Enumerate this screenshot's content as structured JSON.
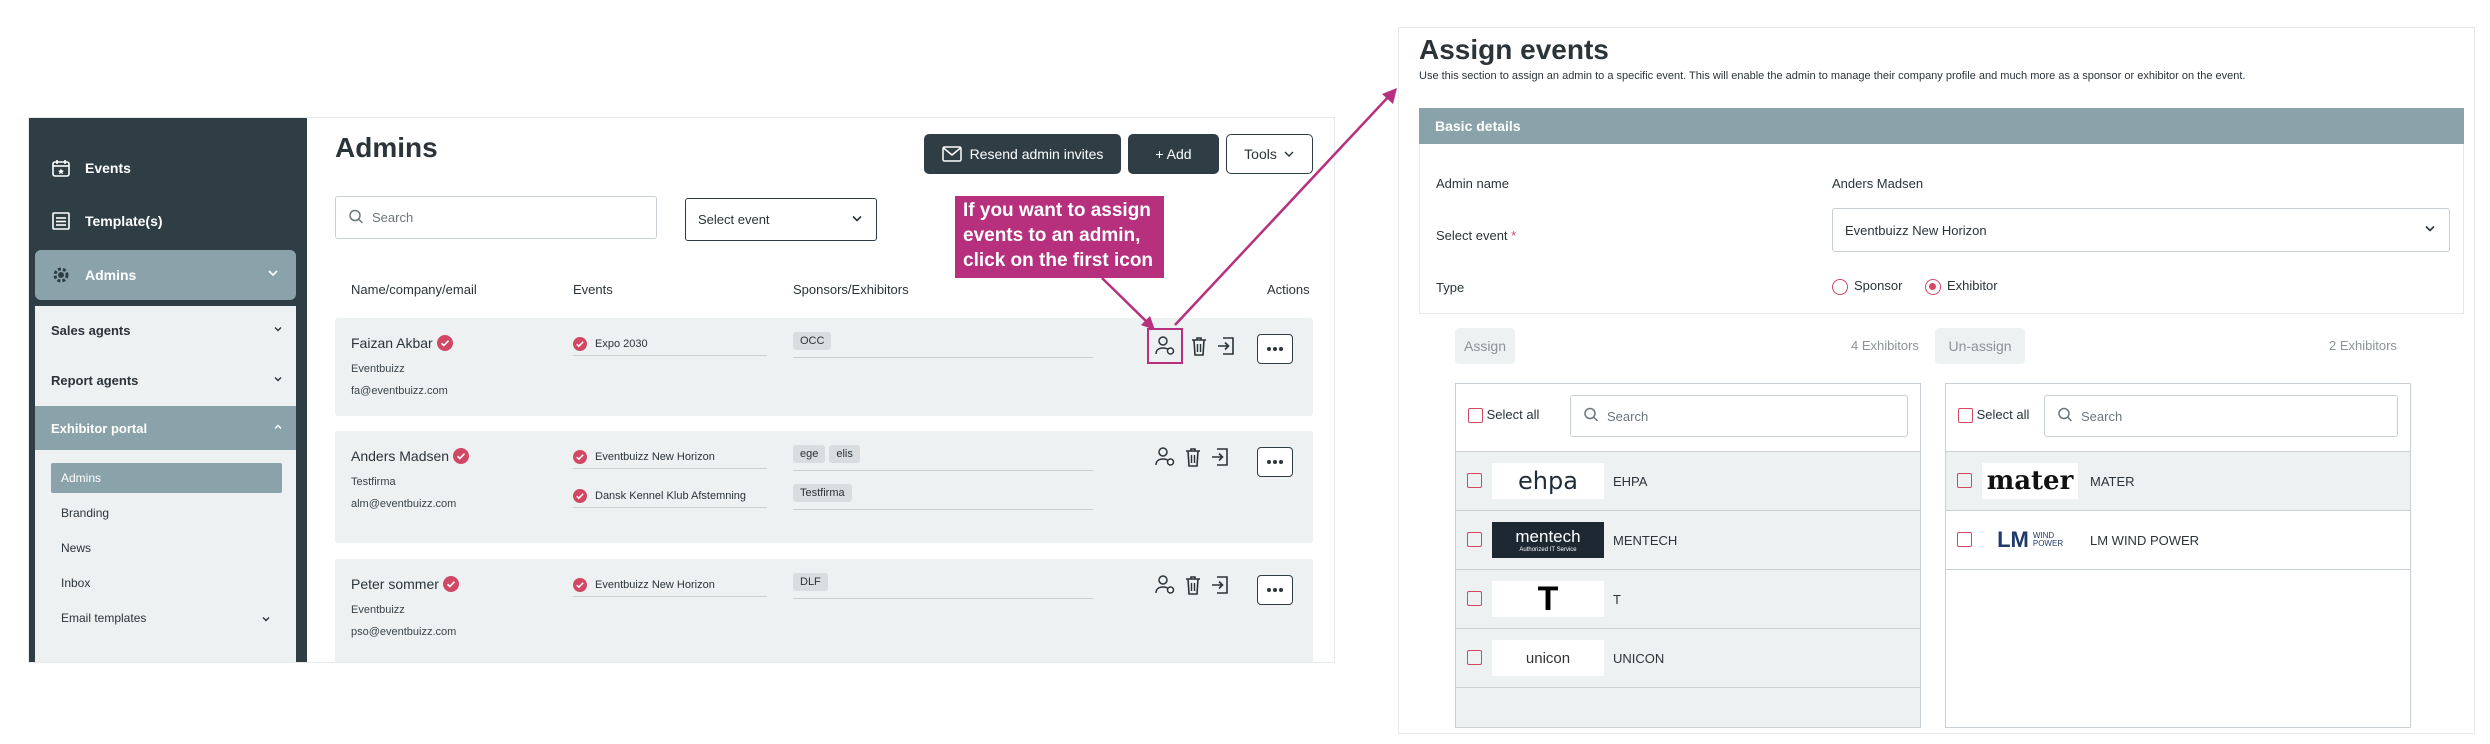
{
  "sidebar": {
    "events": "Events",
    "templates": "Template(s)",
    "admins": "Admins",
    "sales_agents": "Sales agents",
    "report_agents": "Report agents",
    "exhibitor_portal": "Exhibitor portal",
    "sub_items": [
      "Admins",
      "Branding",
      "News",
      "Inbox",
      "Email templates"
    ]
  },
  "main": {
    "title": "Admins",
    "resend_label": "Resend admin invites",
    "add_label": "+ Add",
    "tools_label": "Tools",
    "search_placeholder": "Search",
    "select_event": "Select event",
    "columns": [
      "Name/company/email",
      "Events",
      "Sponsors/Exhibitors",
      "Actions"
    ],
    "rows": [
      {
        "name": "Faizan Akbar",
        "company": "Eventbuizz",
        "email": "fa@eventbuizz.com",
        "events": [
          "Expo 2030"
        ],
        "tags": [
          [
            "OCC"
          ]
        ]
      },
      {
        "name": "Anders Madsen",
        "company": "Testfirma",
        "email": "alm@eventbuizz.com",
        "events": [
          "Eventbuizz New Horizon",
          "Dansk Kennel Klub Afstemning"
        ],
        "tags": [
          [
            "ege",
            "elis"
          ],
          [
            "Testfirma"
          ]
        ]
      },
      {
        "name": "Peter sommer",
        "company": "Eventbuizz",
        "email": "pso@eventbuizz.com",
        "events": [
          "Eventbuizz New Horizon"
        ],
        "tags": [
          [
            "DLF"
          ]
        ]
      }
    ]
  },
  "callout": {
    "line1": "If you want to assign",
    "line2": "events to an admin,",
    "line3": "click on the first icon"
  },
  "assign": {
    "title": "Assign events",
    "description": "Use this section to assign an admin to a specific event. This will enable the admin to manage their company profile and much more as a sponsor or exhibitor on the event.",
    "section_title": "Basic details",
    "admin_name_label": "Admin name",
    "admin_name_value": "Anders Madsen",
    "select_event_label": "Select event",
    "required_mark": "*",
    "select_event_value": "Eventbuizz New Horizon",
    "type_label": "Type",
    "type_options": [
      "Sponsor",
      "Exhibitor"
    ],
    "type_selected": "Exhibitor",
    "assign_label": "Assign",
    "assign_count": "4 Exhibitors",
    "unassign_label": "Un-assign",
    "unassign_count": "2 Exhibitors",
    "select_all": "Select all",
    "search_placeholder": "Search",
    "assign_list": [
      {
        "logo": "ehpa",
        "name": "EHPA"
      },
      {
        "logo": "mentech",
        "logo_sub": "Authorized IT Service",
        "name": "MENTECH"
      },
      {
        "logo": "T",
        "name": "T"
      },
      {
        "logo": "unicon",
        "name": "UNICON"
      }
    ],
    "unassign_list": [
      {
        "logo": "mater",
        "name": "MATER"
      },
      {
        "logo": "LM",
        "logo_sub": "WIND POWER",
        "name": "LM WIND POWER"
      }
    ]
  },
  "colors": {
    "dark": "#2f3e44",
    "accent": "#d14865",
    "teal": "#8aa3aa",
    "callout": "#b6307d"
  }
}
